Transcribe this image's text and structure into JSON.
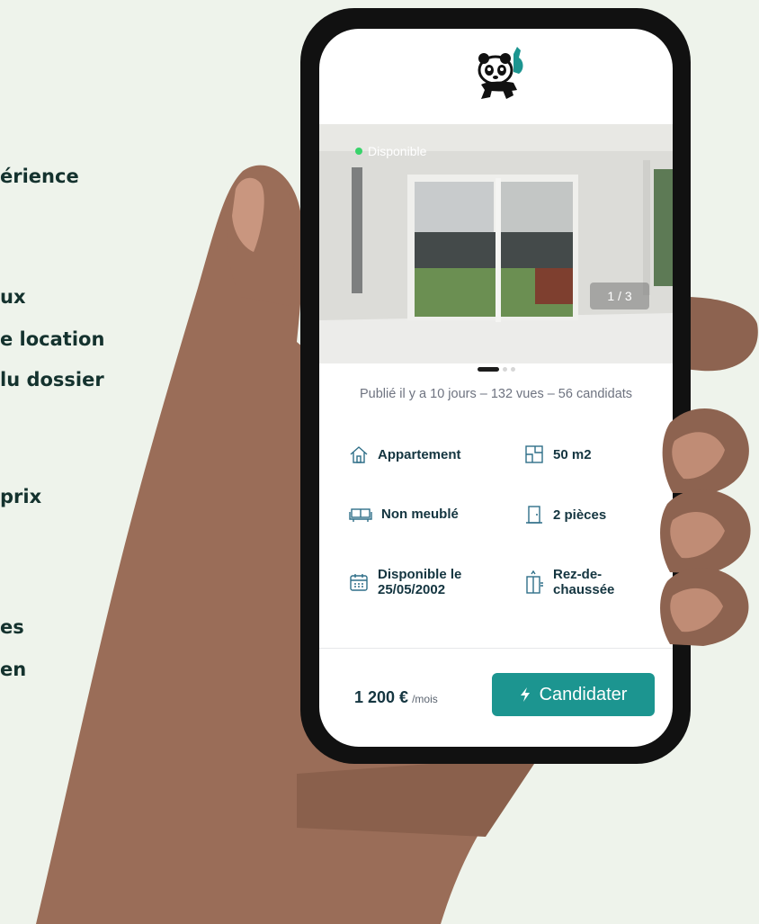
{
  "background_lines": [
    "érience",
    "ux",
    "e location",
    "lu dossier",
    "prix",
    "es",
    "en"
  ],
  "listing": {
    "status": "Disponible",
    "photo_counter": "1 / 3",
    "meta": "Publié il y a 10 jours  –  132 vues  –  56 candidats",
    "features": {
      "type": "Appartement",
      "surface": "50 m2",
      "furnishing": "Non meublé",
      "rooms": "2 pièces",
      "availability": "Disponible le\n25/05/2002",
      "floor": "Rez-de-\nchaussée"
    },
    "price": "1 200 €",
    "price_unit": "/mois",
    "apply_label": "Candidater",
    "apply_icon": "lightning-icon",
    "status_color": "#39d36b",
    "accent_color": "#1c9590"
  }
}
